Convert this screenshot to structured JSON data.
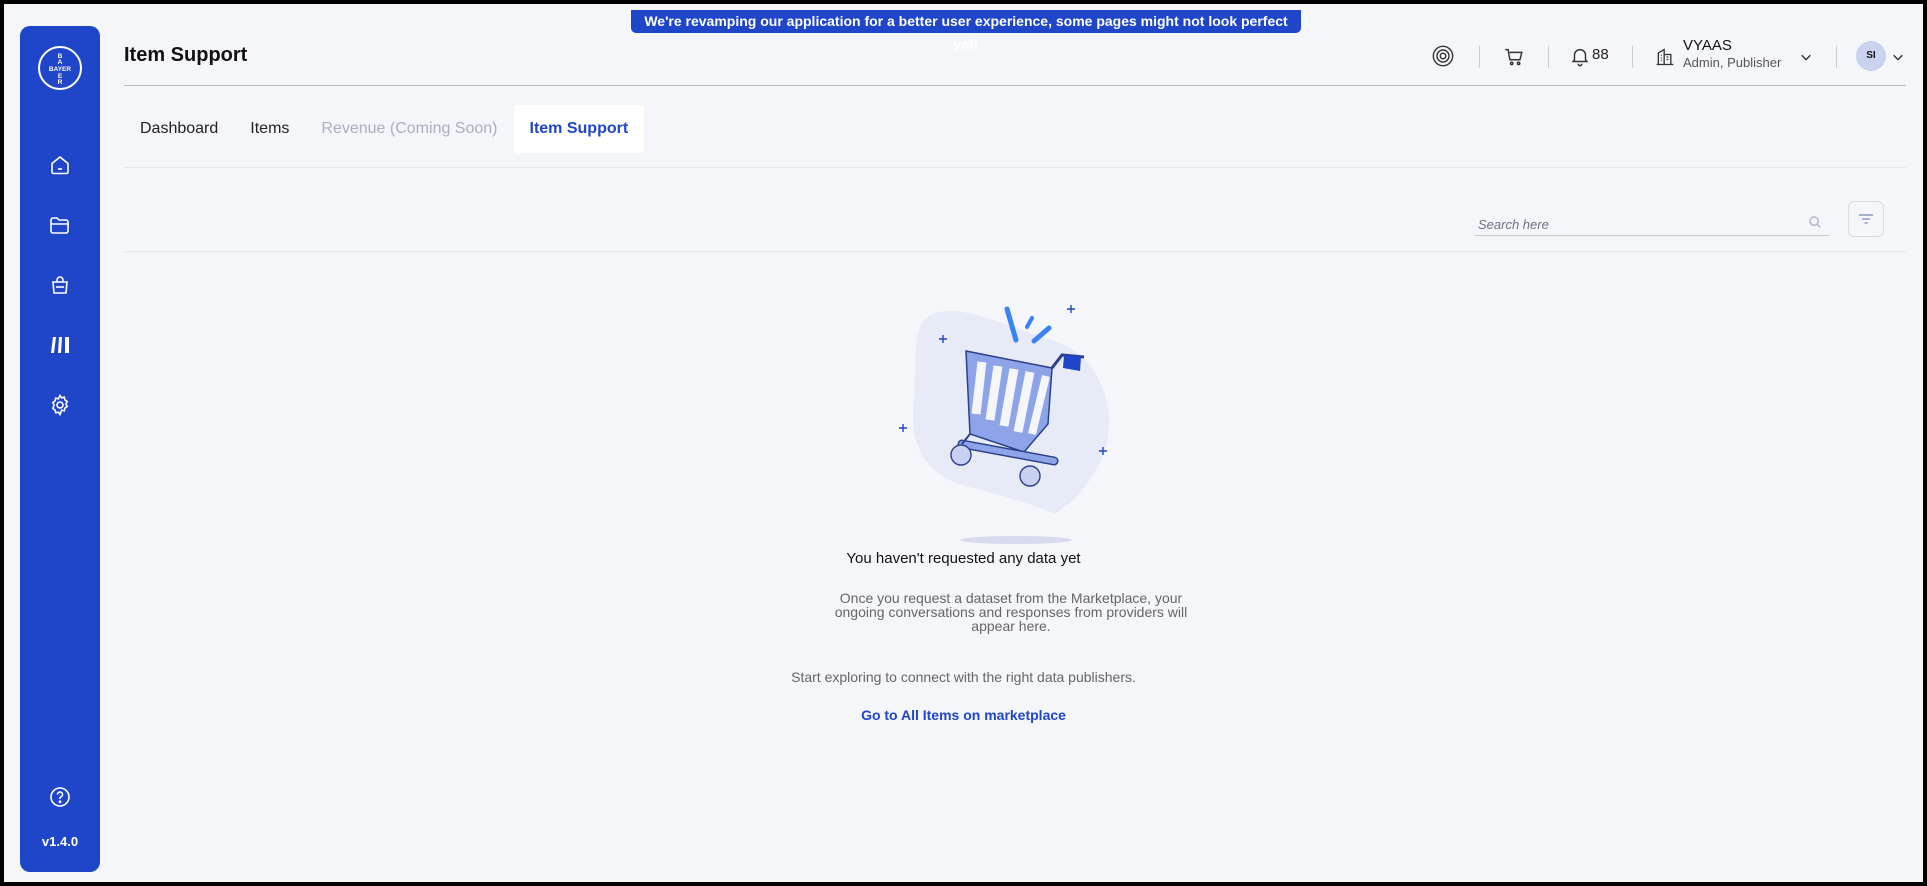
{
  "banner": {
    "text": "We're revamping our application for a better user experience, some pages might not look perfect yet!"
  },
  "sidebar": {
    "logo_text": "BAYER",
    "items": [
      {
        "icon": "home-icon"
      },
      {
        "icon": "folder-icon"
      },
      {
        "icon": "shopping-bag-icon"
      },
      {
        "icon": "library-icon"
      },
      {
        "icon": "gear-icon"
      }
    ],
    "help_icon": "help-icon",
    "version": "v1.4.0"
  },
  "header": {
    "title": "Item Support",
    "notification_count": "88",
    "org_name": "VYAAS",
    "org_role": "Admin, Publisher",
    "avatar_initials": "SI"
  },
  "tabs": [
    {
      "label": "Dashboard",
      "state": "normal"
    },
    {
      "label": "Items",
      "state": "normal"
    },
    {
      "label": "Revenue (Coming Soon)",
      "state": "disabled"
    },
    {
      "label": "Item Support",
      "state": "active"
    }
  ],
  "search": {
    "placeholder": "Search here",
    "value": ""
  },
  "empty_state": {
    "title": "You haven't requested any data yet",
    "description": "Once you request a dataset from the Marketplace, your ongoing conversations and responses from providers will appear here.",
    "hint": "Start exploring to connect with the right data publishers.",
    "cta": "Go to All Items on marketplace"
  },
  "colors": {
    "accent": "#1f45c9",
    "background": "#f4f6fa",
    "cart": "#8ea4e8"
  }
}
